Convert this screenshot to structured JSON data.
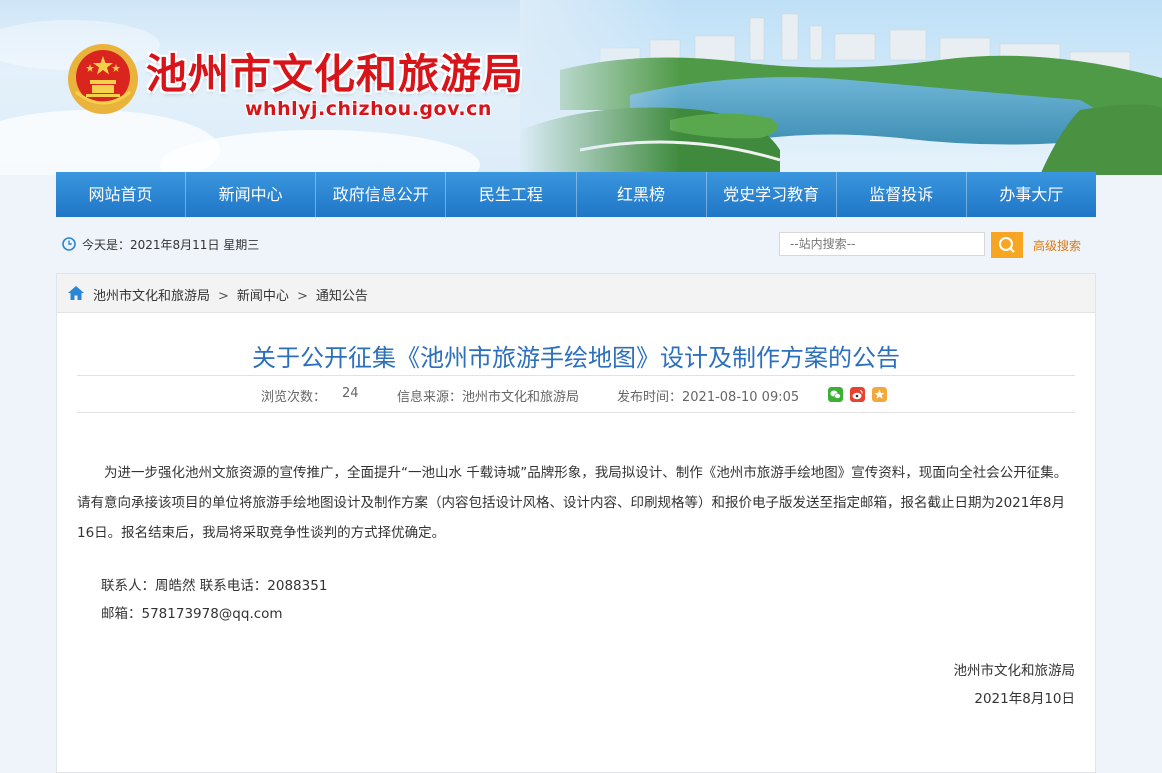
{
  "header": {
    "site_title": "池州市文化和旅游局",
    "site_url": "whhlyj.chizhou.gov.cn"
  },
  "nav": {
    "items": [
      "网站首页",
      "新闻中心",
      "政府信息公开",
      "民生工程",
      "红黑榜",
      "党史学习教育",
      "监督投诉",
      "办事大厅"
    ]
  },
  "infobar": {
    "date": "今天是：2021年8月11日 星期三",
    "search_placeholder": "--站内搜索--",
    "advanced_search": "高级搜索"
  },
  "breadcrumb": {
    "items": [
      "池州市文化和旅游局",
      "新闻中心",
      "通知公告"
    ],
    "separator": ">"
  },
  "article": {
    "title": "关于公开征集《池州市旅游手绘地图》设计及制作方案的公告",
    "views_label": "浏览次数：",
    "views": "24",
    "source": "信息来源：池州市文化和旅游局",
    "published": "发布时间：2021-08-10 09:05",
    "body": "为进一步强化池州文旅资源的宣传推广，全面提升“一池山水 千载诗城”品牌形象，我局拟设计、制作《池州市旅游手绘地图》宣传资料，现面向全社会公开征集。请有意向承接该项目的单位将旅游手绘地图设计及制作方案（内容包括设计风格、设计内容、印刷规格等）和报价电子版发送至指定邮箱，报名截止日期为2021年8月16日。报名结束后，我局将采取竞争性谈判的方式择优确定。",
    "contact_line": "联系人：周皓然  联系电话：2088351",
    "email_line": "邮箱：578173978@qq.com",
    "signature_org": "池州市文化和旅游局",
    "signature_date": "2021年8月10日"
  },
  "colors": {
    "title_red": "#d8141b",
    "nav_blue": "#2b86d4",
    "article_title_blue": "#2c6fbd",
    "search_orange": "#f6a623"
  }
}
